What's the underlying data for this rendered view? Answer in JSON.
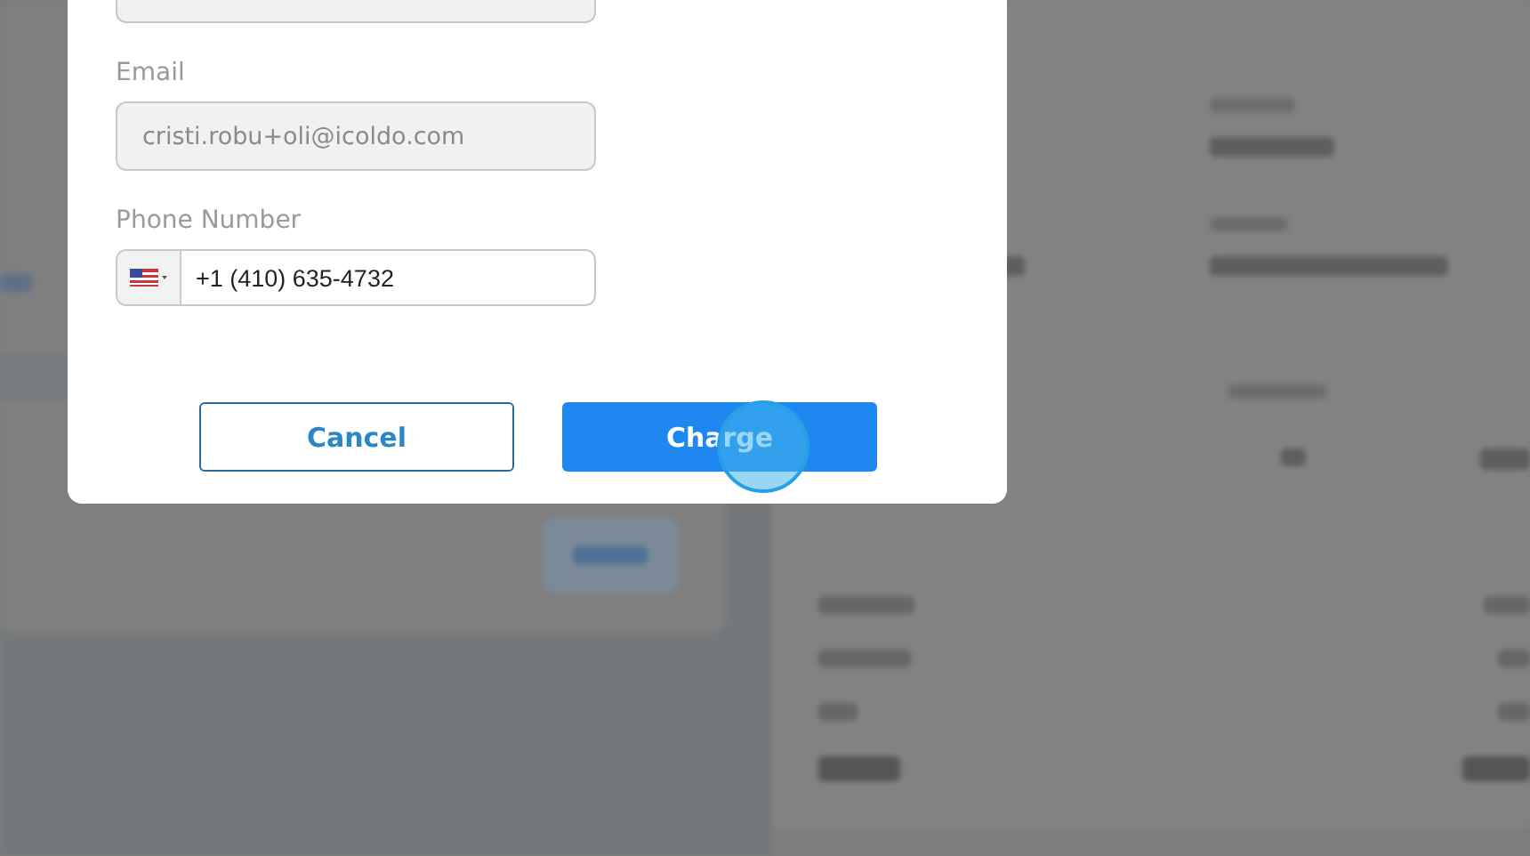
{
  "dialog": {
    "fields": [
      {
        "label": "Email",
        "value": "cristi.robu+oli@icoldo.com",
        "kind": "readonly",
        "disabled": true
      },
      {
        "label": "Phone Number",
        "value": "+1 (410) 635-4732",
        "kind": "phone",
        "disabled": false
      }
    ],
    "buttons": [
      {
        "label": "Cancel",
        "kind": "secondary"
      },
      {
        "label": "Charge",
        "kind": "primary"
      }
    ]
  }
}
